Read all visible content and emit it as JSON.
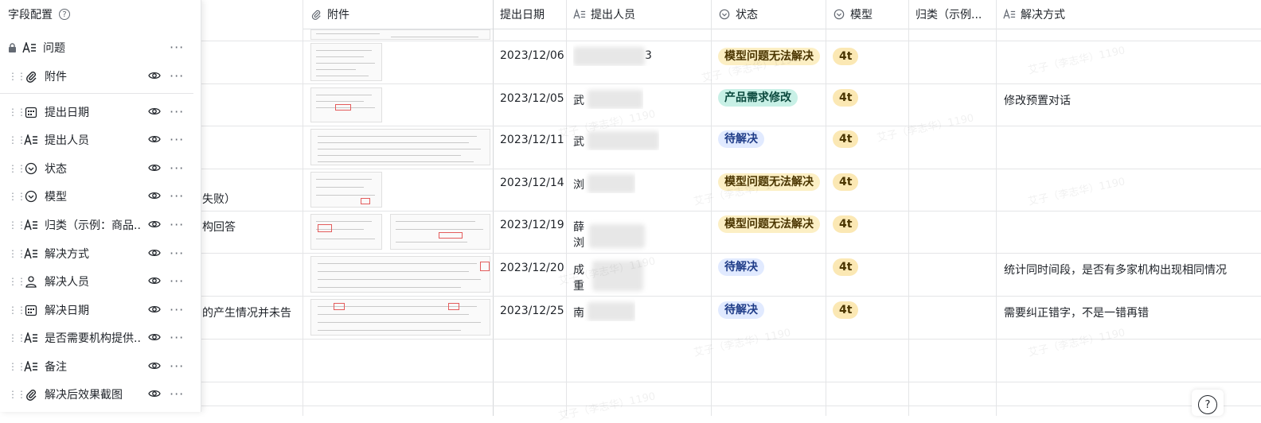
{
  "panel": {
    "title": "字段配置",
    "help_icon": "question-circle-icon",
    "fields": [
      {
        "label": "问题",
        "type_icon": "text-icon",
        "locked": true
      },
      {
        "label": "附件",
        "type_icon": "paperclip-icon",
        "locked": false
      },
      {
        "label": "提出日期",
        "type_icon": "calendar-icon",
        "locked": false
      },
      {
        "label": "提出人员",
        "type_icon": "text-icon",
        "locked": false
      },
      {
        "label": "状态",
        "type_icon": "chevron-circle-icon",
        "locked": false
      },
      {
        "label": "模型",
        "type_icon": "chevron-circle-icon",
        "locked": false
      },
      {
        "label": "归类（示例：商品...",
        "type_icon": "text-icon",
        "locked": false
      },
      {
        "label": "解决方式",
        "type_icon": "text-icon",
        "locked": false
      },
      {
        "label": "解决人员",
        "type_icon": "person-icon",
        "locked": false
      },
      {
        "label": "解决日期",
        "type_icon": "calendar-icon",
        "locked": false
      },
      {
        "label": "是否需要机构提供...",
        "type_icon": "text-icon",
        "locked": false
      },
      {
        "label": "备注",
        "type_icon": "text-icon",
        "locked": false
      },
      {
        "label": "解决后效果截图",
        "type_icon": "paperclip-icon",
        "locked": false
      }
    ]
  },
  "table": {
    "headers": {
      "attachment": "附件",
      "date": "提出日期",
      "person": "提出人员",
      "status": "状态",
      "model": "模型",
      "category": "归类（示例...",
      "solution": "解决方式"
    },
    "rows": [
      {
        "issue_fragment": "",
        "date": "2023/12/06",
        "person_visible": "3",
        "status": "模型问题无法解决",
        "status_kind": "yellow",
        "model": "4t",
        "solution": ""
      },
      {
        "issue_fragment": "",
        "date": "2023/12/05",
        "person_visible": "武",
        "status": "产品需求修改",
        "status_kind": "green",
        "model": "4t",
        "solution": "修改预置对话"
      },
      {
        "issue_fragment": "",
        "date": "2023/12/11",
        "person_visible": "武",
        "status": "待解决",
        "status_kind": "blue",
        "model": "4t",
        "solution": ""
      },
      {
        "issue_fragment": "失败）",
        "date": "2023/12/14",
        "person_visible": "浏",
        "status": "模型问题无法解决",
        "status_kind": "yellow",
        "model": "4t",
        "solution": ""
      },
      {
        "issue_fragment": "构回答",
        "date": "2023/12/19",
        "person_visible": "薛",
        "person_visible2": "浏",
        "status": "模型问题无法解决",
        "status_kind": "yellow",
        "model": "4t",
        "solution": ""
      },
      {
        "issue_fragment": "",
        "date": "2023/12/20",
        "person_visible": "成",
        "person_visible2": "重",
        "status": "待解决",
        "status_kind": "blue",
        "model": "4t",
        "solution": "统计同时间段，是否有多家机构出现相同情况"
      },
      {
        "issue_fragment": "的产生情况并未告",
        "date": "2023/12/25",
        "person_visible": "南",
        "status": "待解决",
        "status_kind": "blue",
        "model": "4t",
        "solution": "需要纠正错字，不是一错再错"
      }
    ]
  },
  "colors": {
    "yellow_bg": "#fcefc4",
    "yellow_fg": "#4a3500",
    "green_bg": "#c8f0e6",
    "green_fg": "#0b4a3e",
    "blue_bg": "#e1eaff",
    "blue_fg": "#1f3c88",
    "model_bg": "#fbe8b4",
    "model_fg": "#4a3500"
  },
  "watermark": "艾子（李志华）1190",
  "help_button": "?"
}
